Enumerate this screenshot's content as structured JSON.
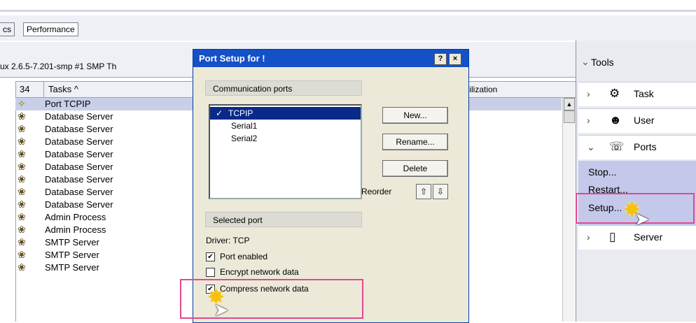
{
  "tabs": [
    "cs",
    "Performance"
  ],
  "server_info": "ux 2.6.5-7.201-smp #1 SMP Th",
  "columns": {
    "count": "34",
    "tasks": "Tasks ^",
    "utilization": "tilization"
  },
  "tasks": [
    "Port TCPIP",
    "Database Server",
    "Database Server",
    "Database Server",
    "Database Server",
    "Database Server",
    "Database Server",
    "Database Server",
    "Database Server",
    "Admin Process",
    "Admin Process",
    "SMTP Server",
    "SMTP Server",
    "SMTP Server"
  ],
  "tools": {
    "title": "Tools",
    "items": [
      "Task",
      "User",
      "Ports",
      "Server"
    ],
    "ports_submenu": [
      "Stop...",
      "Restart...",
      "Setup..."
    ]
  },
  "dialog": {
    "title": "Port Setup for !",
    "help_label": "?",
    "close_label": "×",
    "comm_ports_header": "Communication ports",
    "ports": [
      "TCPIP",
      "Serial1",
      "Serial2"
    ],
    "selected_check": "✓",
    "buttons": {
      "new": "New...",
      "rename": "Rename...",
      "delete": "Delete"
    },
    "reorder_label": "Reorder",
    "selected_port_header": "Selected port",
    "driver": "Driver: TCP",
    "checkboxes": [
      {
        "label": "Port enabled",
        "checked": true
      },
      {
        "label": "Encrypt network data",
        "checked": false
      },
      {
        "label": "Compress network data",
        "checked": true
      }
    ]
  },
  "colors": {
    "selection": "#0a2a8a",
    "highlight_box": "#e0498f",
    "title_bar": "#1450c8",
    "submenu": "#c4c8ea"
  }
}
